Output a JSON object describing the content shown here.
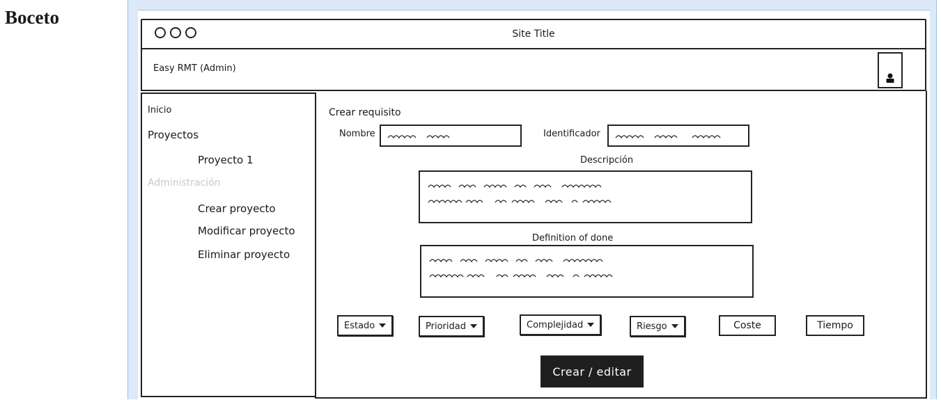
{
  "page_label": "Boceto",
  "window": {
    "title": "Site Title"
  },
  "header": {
    "app_name": "Easy RMT (Admin)"
  },
  "sidebar": {
    "items": [
      {
        "label": "Inicio"
      },
      {
        "label": "Proyectos"
      },
      {
        "label": "Proyecto 1"
      },
      {
        "label": "Administración"
      },
      {
        "label": "Crear proyecto"
      },
      {
        "label": "Modificar proyecto"
      },
      {
        "label": "Eliminar proyecto"
      }
    ]
  },
  "form": {
    "heading": "Crear requisito",
    "nombre_label": "Nombre",
    "identificador_label": "Identificador",
    "descripcion_label": "Descripción",
    "dod_label": "Definition of done",
    "dropdowns": [
      {
        "label": "Estado"
      },
      {
        "label": "Prioridad"
      },
      {
        "label": "Complejidad"
      },
      {
        "label": "Riesgo"
      }
    ],
    "buttons": [
      {
        "label": "Coste"
      },
      {
        "label": "Tiempo"
      }
    ],
    "submit_label": "Crear / editar"
  },
  "icons": {
    "user": "user-icon",
    "window_controls": "circle-icon",
    "dropdown": "caret-down-icon"
  }
}
